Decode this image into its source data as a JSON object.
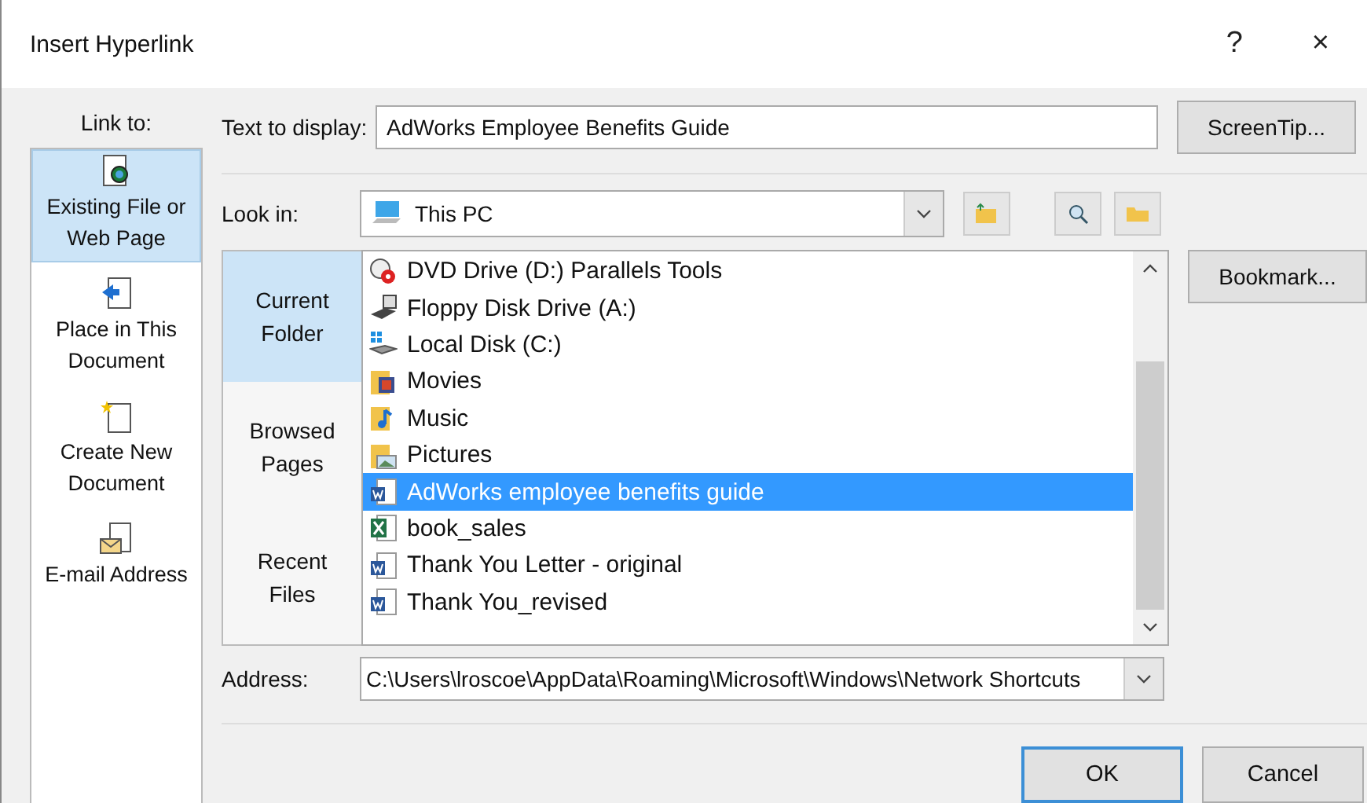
{
  "window": {
    "title": "Insert Hyperlink",
    "help": "?",
    "close": "×"
  },
  "link_to": {
    "label": "Link to:",
    "items": [
      {
        "kind": "file",
        "label": "Existing File or Web Page",
        "selected": true
      },
      {
        "kind": "place",
        "label": "Place in This Document",
        "selected": false
      },
      {
        "kind": "new",
        "label": "Create New Document",
        "selected": false
      },
      {
        "kind": "email",
        "label": "E-mail Address",
        "selected": false
      }
    ]
  },
  "text_to_display": {
    "label": "Text to display:",
    "value": "AdWorks Employee Benefits Guide"
  },
  "screentip_button": "ScreenTip...",
  "look_in": {
    "label": "Look in:",
    "value": "This PC"
  },
  "nav": [
    {
      "label": "Current Folder",
      "selected": true
    },
    {
      "label": "Browsed Pages",
      "selected": false
    },
    {
      "label": "Recent Files",
      "selected": false
    }
  ],
  "files": [
    {
      "kind": "dvd",
      "name": "DVD Drive (D:) Parallels Tools",
      "selected": false
    },
    {
      "kind": "floppy",
      "name": "Floppy Disk Drive (A:)",
      "selected": false
    },
    {
      "kind": "disk",
      "name": "Local Disk (C:)",
      "selected": false
    },
    {
      "kind": "movies",
      "name": "Movies",
      "selected": false
    },
    {
      "kind": "music",
      "name": "Music",
      "selected": false
    },
    {
      "kind": "pictures",
      "name": "Pictures",
      "selected": false
    },
    {
      "kind": "word",
      "name": "AdWorks employee benefits guide",
      "selected": true
    },
    {
      "kind": "excel",
      "name": "book_sales",
      "selected": false
    },
    {
      "kind": "word",
      "name": "Thank You Letter - original",
      "selected": false
    },
    {
      "kind": "word",
      "name": "Thank You_revised",
      "selected": false
    }
  ],
  "bookmark_button": "Bookmark...",
  "address": {
    "label": "Address:",
    "value": "C:\\Users\\lroscoe\\AppData\\Roaming\\Microsoft\\Windows\\Network Shortcuts"
  },
  "buttons": [
    {
      "label": "OK",
      "default": true
    },
    {
      "label": "Cancel",
      "default": false
    }
  ]
}
